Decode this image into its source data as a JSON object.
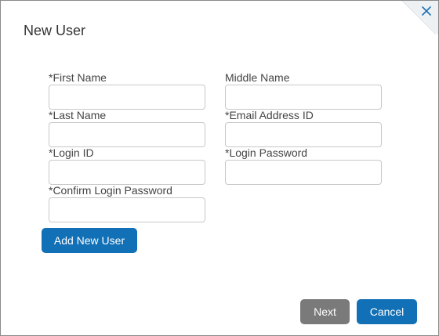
{
  "dialog": {
    "title": "New User",
    "close_icon": "close-icon"
  },
  "form": {
    "first_name": {
      "label": "*First Name",
      "value": ""
    },
    "middle_name": {
      "label": "Middle Name",
      "value": ""
    },
    "last_name": {
      "label": "*Last Name",
      "value": ""
    },
    "email_address_id": {
      "label": "*Email Address ID",
      "value": ""
    },
    "login_id": {
      "label": "*Login ID",
      "value": ""
    },
    "login_password": {
      "label": "*Login Password",
      "value": ""
    },
    "confirm_login_password": {
      "label": "*Confirm Login Password",
      "value": ""
    },
    "add_new_user_label": "Add New User"
  },
  "footer": {
    "next_label": "Next",
    "cancel_label": "Cancel"
  },
  "colors": {
    "primary": "#1170b6",
    "secondary": "#7a7a7a",
    "close": "#1f6fb5"
  }
}
